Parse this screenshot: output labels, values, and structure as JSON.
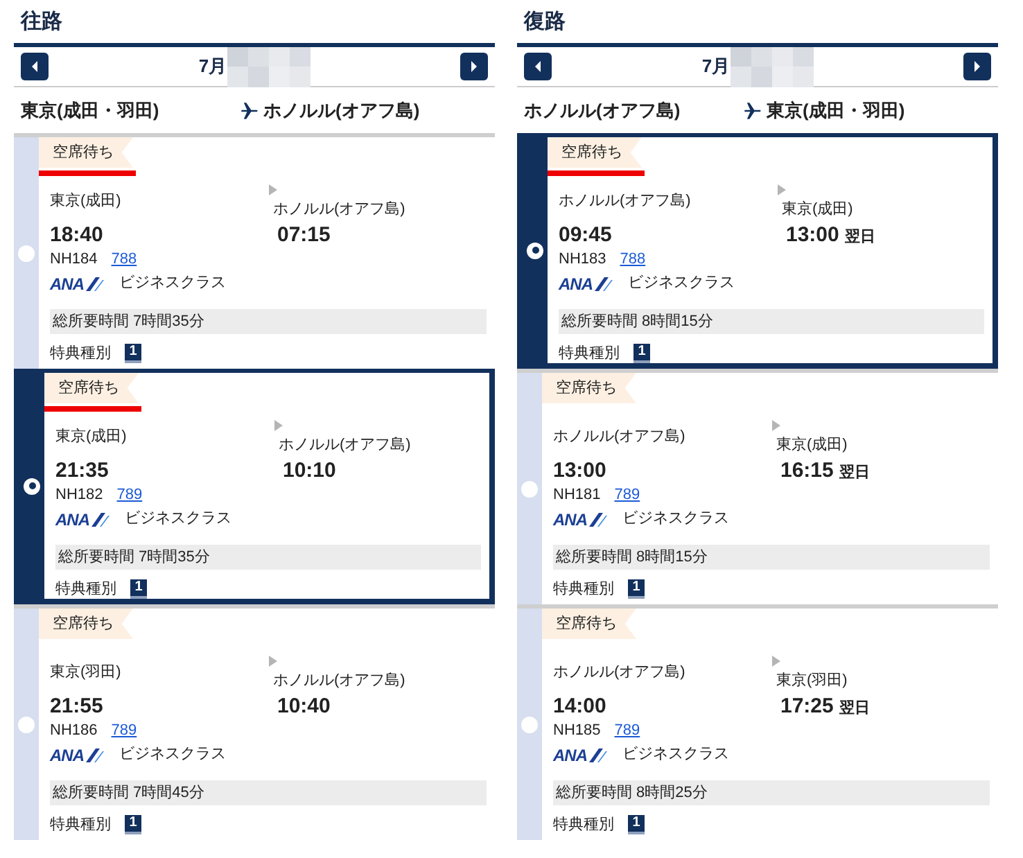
{
  "columns": [
    {
      "title": "往路",
      "month": "7月",
      "origin": "東京(成田・羽田)",
      "destination": "ホノルル(オアフ島)",
      "flights": [
        {
          "selected": false,
          "highlighted": true,
          "status": "空席待ち",
          "dep_city": "東京(成田)",
          "dep_time": "18:40",
          "arr_city": "ホノルル(オアフ島)",
          "arr_time": "07:15",
          "flight_no": "NH184",
          "aircraft": "788",
          "airline": "ANA",
          "cabin": "ビジネスクラス",
          "duration": "総所要時間 7時間35分",
          "award_label": "特典種別",
          "award_type": "1"
        },
        {
          "selected": true,
          "highlighted": true,
          "status": "空席待ち",
          "dep_city": "東京(成田)",
          "dep_time": "21:35",
          "arr_city": "ホノルル(オアフ島)",
          "arr_time": "10:10",
          "flight_no": "NH182",
          "aircraft": "789",
          "airline": "ANA",
          "cabin": "ビジネスクラス",
          "duration": "総所要時間 7時間35分",
          "award_label": "特典種別",
          "award_type": "1"
        },
        {
          "selected": false,
          "highlighted": false,
          "status": "空席待ち",
          "dep_city": "東京(羽田)",
          "dep_time": "21:55",
          "arr_city": "ホノルル(オアフ島)",
          "arr_time": "10:40",
          "flight_no": "NH186",
          "aircraft": "789",
          "airline": "ANA",
          "cabin": "ビジネスクラス",
          "duration": "総所要時間 7時間45分",
          "award_label": "特典種別",
          "award_type": "1"
        }
      ]
    },
    {
      "title": "復路",
      "month": "7月",
      "origin": "ホノルル(オアフ島)",
      "destination": "東京(成田・羽田)",
      "flights": [
        {
          "selected": true,
          "highlighted": true,
          "status": "空席待ち",
          "dep_city": "ホノルル(オアフ島)",
          "dep_time": "09:45",
          "arr_city": "東京(成田)",
          "arr_time": "13:00",
          "next_day": "翌日",
          "flight_no": "NH183",
          "aircraft": "788",
          "airline": "ANA",
          "cabin": "ビジネスクラス",
          "duration": "総所要時間 8時間15分",
          "award_label": "特典種別",
          "award_type": "1"
        },
        {
          "selected": false,
          "highlighted": false,
          "status": "空席待ち",
          "dep_city": "ホノルル(オアフ島)",
          "dep_time": "13:00",
          "arr_city": "東京(成田)",
          "arr_time": "16:15",
          "next_day": "翌日",
          "flight_no": "NH181",
          "aircraft": "789",
          "airline": "ANA",
          "cabin": "ビジネスクラス",
          "duration": "総所要時間 8時間15分",
          "award_label": "特典種別",
          "award_type": "1"
        },
        {
          "selected": false,
          "highlighted": false,
          "status": "空席待ち",
          "dep_city": "ホノルル(オアフ島)",
          "dep_time": "14:00",
          "arr_city": "東京(羽田)",
          "arr_time": "17:25",
          "next_day": "翌日",
          "flight_no": "NH185",
          "aircraft": "789",
          "airline": "ANA",
          "cabin": "ビジネスクラス",
          "duration": "総所要時間 8時間25分",
          "award_label": "特典種別",
          "award_type": "1"
        }
      ]
    }
  ]
}
